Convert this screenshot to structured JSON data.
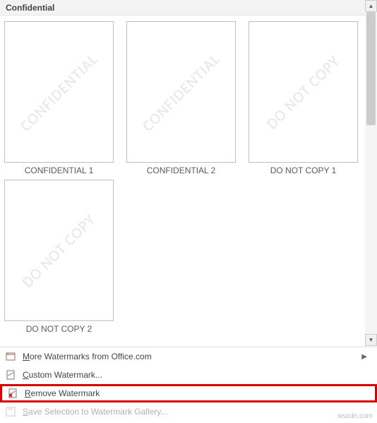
{
  "header": {
    "title": "Confidential"
  },
  "items": [
    {
      "label": "CONFIDENTIAL 1",
      "watermark": "CONFIDENTIAL"
    },
    {
      "label": "CONFIDENTIAL 2",
      "watermark": "CONFIDENTIAL"
    },
    {
      "label": "DO NOT COPY 1",
      "watermark": "DO NOT COPY"
    },
    {
      "label": "DO NOT COPY 2",
      "watermark": "DO NOT COPY"
    }
  ],
  "menu": {
    "more": "More Watermarks from Office.com",
    "custom": "Custom Watermark...",
    "remove": "Remove Watermark",
    "save": "Save Selection to Watermark Gallery..."
  },
  "attribution": "wsxdn.com"
}
